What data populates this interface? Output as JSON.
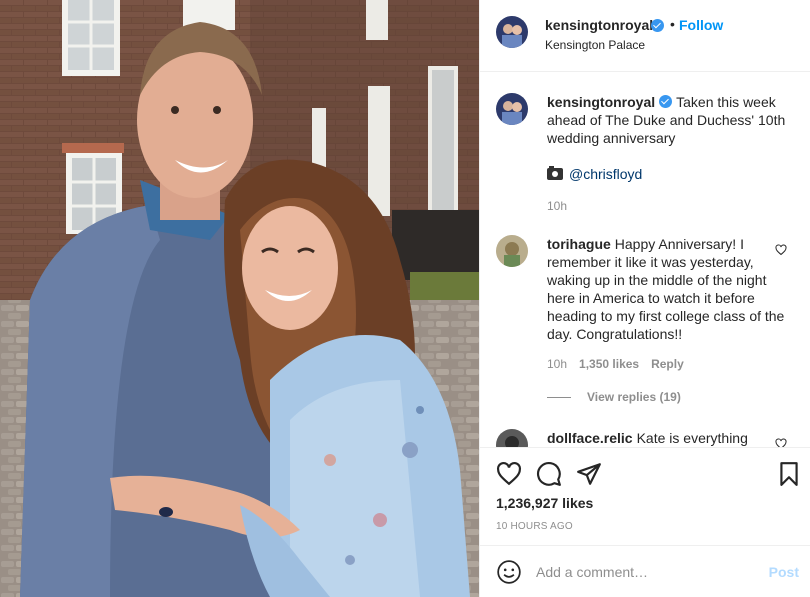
{
  "post": {
    "image_alt": "Photo of the Duke and Duchess embracing in a courtyard"
  },
  "header": {
    "username": "kensingtonroyal",
    "separator": "•",
    "follow_label": "Follow",
    "location": "Kensington Palace"
  },
  "caption": {
    "username": "kensingtonroyal",
    "text": "Taken this week ahead of The Duke and Duchess' 10th wedding anniversary",
    "mention": "@chrisfloyd",
    "time": "10h"
  },
  "comments": [
    {
      "username": "torihague",
      "text": "Happy Anniversary! I remember it like it was yesterday, waking up in the middle of the night here in America to watch it before heading to my first college class of the day. Congratulations!!",
      "time": "10h",
      "likes": "1,350 likes",
      "reply_label": "Reply",
      "view_replies": "View replies (19)"
    },
    {
      "username": "dollface.relic",
      "text": "Kate is everything"
    }
  ],
  "actions": {
    "likes": "1,236,927 likes",
    "time_ago": "10 HOURS AGO"
  },
  "add_comment": {
    "placeholder": "Add a comment…",
    "post_label": "Post"
  },
  "colors": {
    "accent": "#0095f6",
    "verified": "#3897f0",
    "muted": "#8e8e8e",
    "post_disabled": "#b3dbff"
  },
  "icons": [
    "verified-icon",
    "camera-icon",
    "heart-icon",
    "comment-icon",
    "share-icon",
    "bookmark-icon",
    "emoji-icon"
  ]
}
